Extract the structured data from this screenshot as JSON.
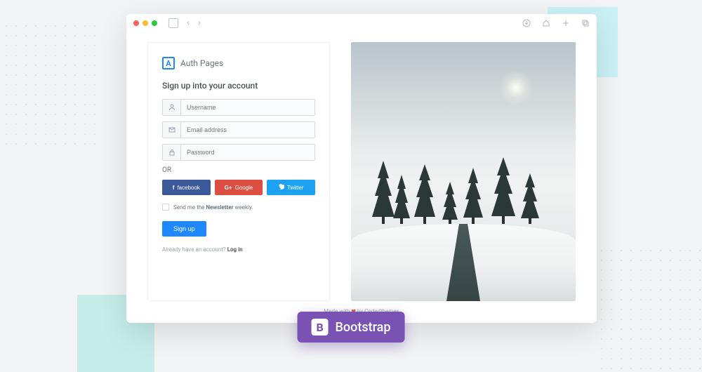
{
  "brand": {
    "icon_letter": "A",
    "name": "Auth Pages"
  },
  "form": {
    "heading": "Sign up into your account",
    "username_placeholder": "Username",
    "email_placeholder": "Email address",
    "password_placeholder": "Password",
    "or_label": "OR",
    "social": {
      "facebook": "facebook",
      "google": "Google",
      "twitter": "Twitter"
    },
    "newsletter_prefix": "Send me the ",
    "newsletter_bold": "Newsletter",
    "newsletter_suffix": " weekly.",
    "submit": "Sign up",
    "already_text": "Already have an account? ",
    "login_link": "Log in"
  },
  "footer": {
    "prefix": "Made with ",
    "heart": "❤",
    "suffix": " by Codedthemes"
  },
  "badge": {
    "icon": "B",
    "text": "Bootstrap"
  }
}
